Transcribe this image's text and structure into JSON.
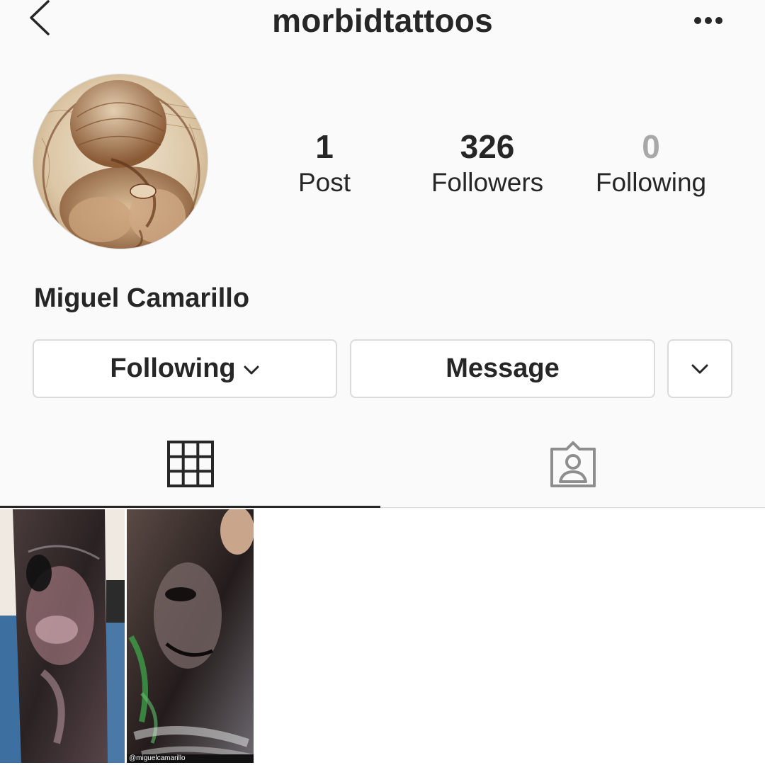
{
  "header": {
    "username": "morbidtattoos",
    "back_icon": "chevron-left-icon",
    "more_icon": "more-horizontal-icon"
  },
  "profile": {
    "full_name": "Miguel Camarillo",
    "stats": {
      "posts": {
        "count": "1",
        "label": "Post"
      },
      "followers": {
        "count": "326",
        "label": "Followers"
      },
      "following": {
        "count": "0",
        "label": "Following"
      }
    }
  },
  "actions": {
    "following_label": "Following",
    "message_label": "Message"
  },
  "tabs": {
    "grid_icon": "grid-icon",
    "tagged_icon": "tagged-person-icon",
    "active": "grid"
  },
  "posts": [
    {
      "caption": "@miguelcamarillo"
    }
  ],
  "colors": {
    "background": "#fafafa",
    "text": "#262626",
    "border": "#dbdbdb",
    "muted": "#a8a8a8"
  }
}
